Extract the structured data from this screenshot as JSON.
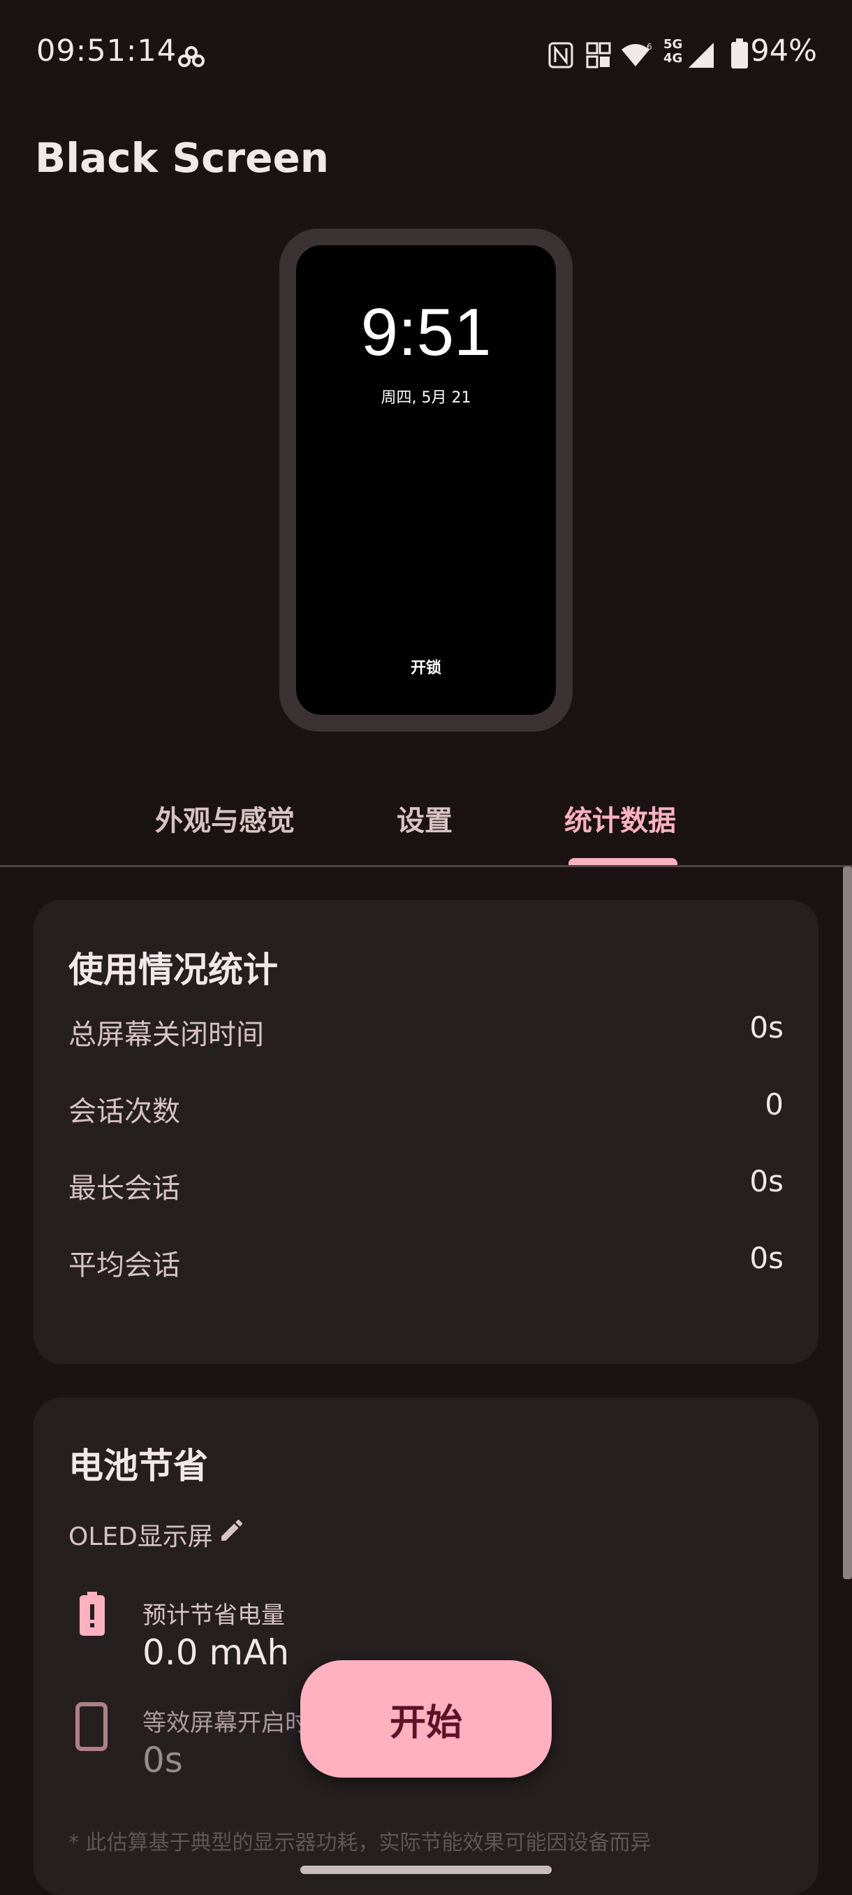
{
  "status_bar": {
    "time": "09:51:14",
    "battery": "94%",
    "network": "5G 4G"
  },
  "app": {
    "title": "Black Screen"
  },
  "preview": {
    "time": "9:51",
    "date": "周四, 5月 21",
    "unlock": "开锁"
  },
  "tabs": [
    {
      "label": "外观与感觉",
      "active": false
    },
    {
      "label": "设置",
      "active": false
    },
    {
      "label": "统计数据",
      "active": true
    }
  ],
  "usage": {
    "title": "使用情况统计",
    "rows": [
      {
        "label": "总屏幕关闭时间",
        "value": "0s"
      },
      {
        "label": "会话次数",
        "value": "0"
      },
      {
        "label": "最长会话",
        "value": "0s"
      },
      {
        "label": "平均会话",
        "value": "0s"
      }
    ]
  },
  "battery": {
    "title": "电池节省",
    "display_type": "OLED显示屏",
    "stats": [
      {
        "label": "预计节省电量",
        "value": "0.0 mAh",
        "icon": "battery-alert-icon"
      },
      {
        "label": "等效屏幕开启时",
        "value": "0s",
        "icon": "phone-icon"
      }
    ],
    "footnote": "* 此估算基于典型的显示器功耗，实际节能效果可能因设备而异"
  },
  "start_button": {
    "label": "开始"
  },
  "colors": {
    "accent": "#ffb1c0",
    "background": "#1a1213",
    "card": "#251f20"
  }
}
